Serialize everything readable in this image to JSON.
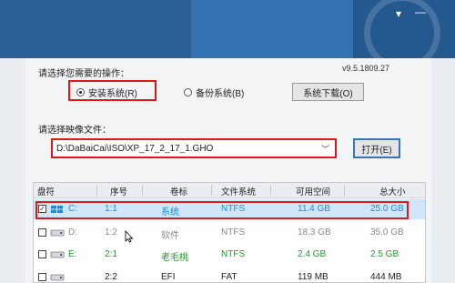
{
  "window": {
    "menu_icon": "hamburger-icon",
    "minimize_icon": "minimize-icon"
  },
  "panel": {
    "op_label": "请选择您需要的操作：",
    "version": "v9.5.1809.27",
    "radios": [
      {
        "label": "安装系统(R)",
        "checked": true
      },
      {
        "label": "备份系统(B)",
        "checked": false
      }
    ],
    "download_button": "系统下载(O)",
    "image_label": "请选择映像文件：",
    "image_path": "D:\\DaBaiCai\\ISO\\XP_17_2_17_1.GHO",
    "open_button": "打开(E)"
  },
  "table": {
    "headers": [
      "盘符",
      "序号",
      "卷标",
      "文件系统",
      "可用空间",
      "总大小"
    ],
    "rows": [
      {
        "checked": true,
        "drive": "C:",
        "index": "1:1",
        "label": "系统",
        "fs": "NTFS",
        "free": "11.4 GB",
        "total": "25.0 GB",
        "color": "#1a8fd8",
        "icon": "windows-drive-icon",
        "selected": true
      },
      {
        "checked": false,
        "drive": "D:",
        "index": "1:2",
        "label": "软件",
        "fs": "NTFS",
        "free": "18.3 GB",
        "total": "35.0 GB",
        "color": "#8a8a8a",
        "icon": "drive-icon",
        "selected": false
      },
      {
        "checked": false,
        "drive": "E:",
        "index": "2:1",
        "label": "老毛桃",
        "fs": "NTFS",
        "free": "2.4 GB",
        "total": "2.5 GB",
        "color": "#1f9a2a",
        "icon": "drive-icon",
        "selected": false
      },
      {
        "checked": false,
        "drive": "",
        "index": "2:2",
        "label": "EFI",
        "fs": "FAT",
        "free": "119 MB",
        "total": "444 MB",
        "color": "#222222",
        "icon": "drive-icon",
        "selected": false
      }
    ]
  }
}
